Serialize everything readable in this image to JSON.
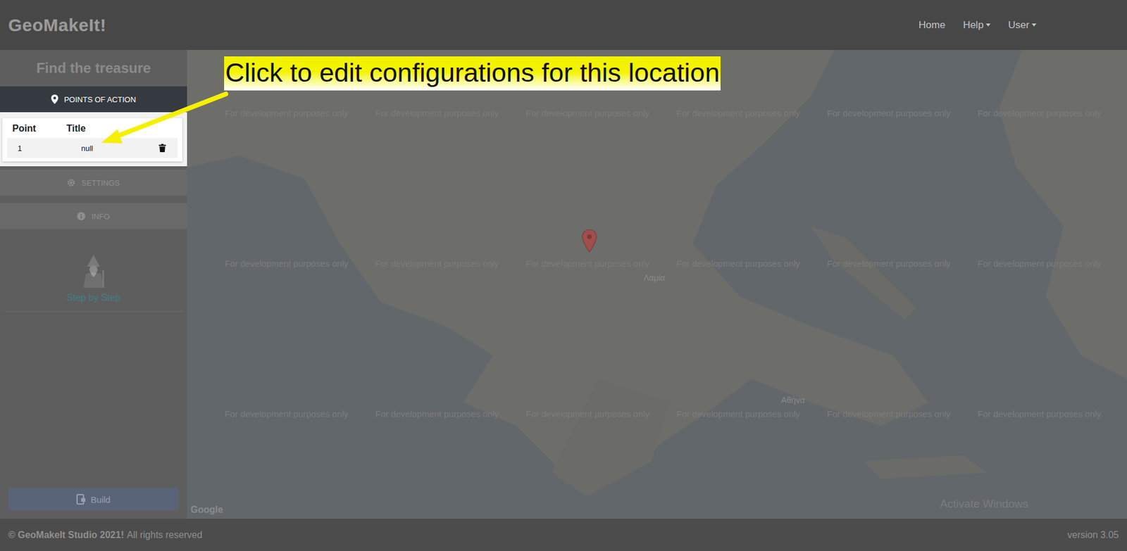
{
  "app": {
    "logo": "GeoMakeIt!"
  },
  "nav": [
    {
      "label": "Home",
      "dropdown": false
    },
    {
      "label": "Help",
      "dropdown": true
    },
    {
      "label": "User",
      "dropdown": true
    }
  ],
  "sidebar": {
    "title": "Find the treasure",
    "sections": [
      {
        "label": "POINTS OF ACTION",
        "kind": "points",
        "expanded": true
      },
      {
        "label": "SETTINGS",
        "kind": "settings",
        "expanded": false
      },
      {
        "label": "INFO",
        "kind": "info",
        "expanded": false
      }
    ],
    "points_table": {
      "columns": [
        "Point",
        "Title"
      ],
      "rows": [
        [
          "1",
          "null"
        ]
      ]
    },
    "guide": {
      "label": "Step by Step"
    },
    "build_button": "Build"
  },
  "map": {
    "watermarks": [
      "For development purposes only",
      "For development purposes only",
      "For development purposes only",
      "For development purposes only",
      "For development purposes only",
      "For development purposes only",
      "For development purposes only",
      "For development purposes only",
      "For development purposes only",
      "For development purposes only",
      "For development purposes only",
      "For development purposes only",
      "For development purposes only",
      "For development purposes only",
      "For development purposes only",
      "For development purposes only",
      "For development purposes only",
      "For development purposes only"
    ],
    "labels": [
      "Αθήνα",
      "Λαμία"
    ],
    "google": "Google",
    "activate": "Activate Windows"
  },
  "tooltip": {
    "text": "Click to edit configurations for this location"
  },
  "footer": {
    "copyright": "© GeoMakeIt Studio 2021!",
    "rights": "All rights reserved",
    "version": "version 3.05"
  }
}
